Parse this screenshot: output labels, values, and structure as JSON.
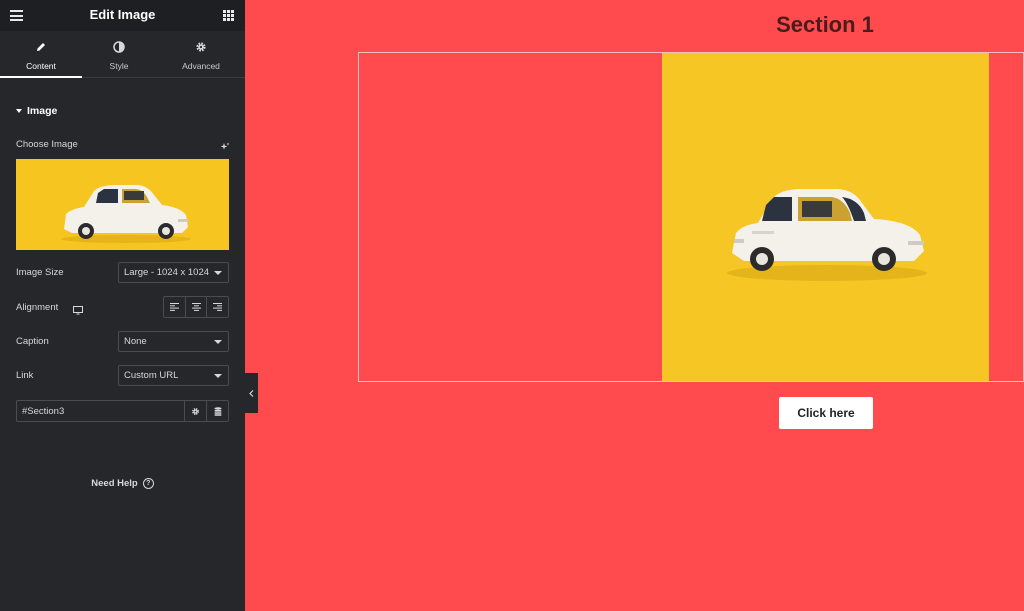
{
  "editor": {
    "title": "Edit Image",
    "tabs": [
      {
        "label": "Content"
      },
      {
        "label": "Style"
      },
      {
        "label": "Advanced"
      }
    ],
    "section": "Image",
    "choose_image_label": "Choose Image",
    "image_size": {
      "label": "Image Size",
      "value": "Large - 1024 x 1024"
    },
    "alignment": {
      "label": "Alignment"
    },
    "caption": {
      "label": "Caption",
      "value": "None"
    },
    "link": {
      "label": "Link",
      "value": "Custom URL",
      "url": "#Section3"
    },
    "need_help": "Need Help"
  },
  "canvas": {
    "section_title": "Section 1",
    "button_label": "Click here"
  },
  "colors": {
    "canvas_bg": "#ff4b4d",
    "panel_bg": "#26272b",
    "image_bg": "#f6c724"
  }
}
